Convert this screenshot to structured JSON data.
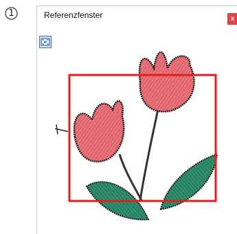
{
  "step_marker": "1",
  "window": {
    "title": "Referenzfenster",
    "close_label": "x"
  },
  "colors": {
    "close": "#e04343",
    "frame": "#e01f1f",
    "tulip": "#e8717a",
    "leaf": "#2e8d6c",
    "stitch": "#222222"
  },
  "icons": [
    "step-number-icon",
    "fit-to-window-icon",
    "close-icon"
  ]
}
